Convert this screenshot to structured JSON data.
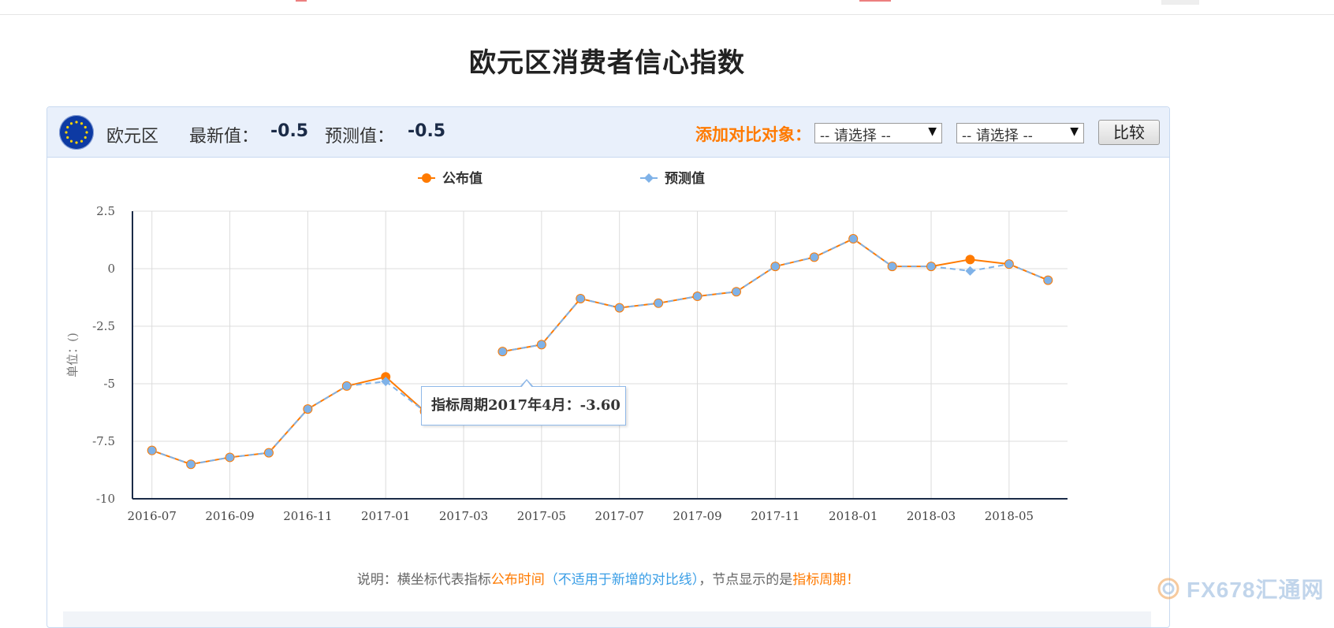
{
  "page": {
    "title": "欧元区消费者信心指数"
  },
  "header": {
    "region": "欧元区",
    "latest_label": "最新值：",
    "latest_value": "-0.5",
    "forecast_label": "预测值：",
    "forecast_value": "-0.5",
    "compare_label": "添加对比对象：",
    "select1": "-- 请选择 --",
    "select2": "-- 请选择 --",
    "compare_button": "比较"
  },
  "tooltip": {
    "text": "指标周期2017年4月：-3.60"
  },
  "footnote": {
    "prefix": "说明：横坐标代表指标",
    "highlight1": "公布时间",
    "paren": "（不适用于新增的对比线）",
    "middle": "，节点显示的是",
    "highlight2": "指标周期",
    "suffix": "！"
  },
  "watermark": "FX678汇通网",
  "chart_data": {
    "type": "line",
    "ylabel": "单位：()",
    "ylim": [
      -10,
      2.5
    ],
    "yticks": [
      2.5,
      0,
      -2.5,
      -5,
      -7.5,
      -10
    ],
    "ytick_labels": [
      "2.5",
      "0",
      "-2.5",
      "-5",
      "-7.5",
      "-10"
    ],
    "x": [
      "2016-07",
      "2016-08",
      "2016-09",
      "2016-10",
      "2016-11",
      "2016-12",
      "2017-01",
      "2017-02",
      "2017-03",
      "2017-04",
      "2017-05",
      "2017-06",
      "2017-07",
      "2017-08",
      "2017-09",
      "2017-10",
      "2017-11",
      "2017-12",
      "2018-01",
      "2018-02",
      "2018-03",
      "2018-04",
      "2018-05",
      "2018-06"
    ],
    "xtick_labels": [
      "2016-07",
      "2016-09",
      "2016-11",
      "2017-01",
      "2017-03",
      "2017-05",
      "2017-07",
      "2017-09",
      "2017-11",
      "2018-01",
      "2018-03",
      "2018-05"
    ],
    "grid": true,
    "legend_position": "top-center",
    "series": [
      {
        "name": "公布值",
        "color": "#ff7a00",
        "values": [
          -7.9,
          -8.5,
          -8.2,
          -8.0,
          -6.1,
          -5.1,
          -4.7,
          -6.2,
          null,
          -3.6,
          -3.3,
          -1.3,
          -1.7,
          -1.5,
          -1.2,
          -1.0,
          0.1,
          0.5,
          1.3,
          0.1,
          0.1,
          0.4,
          0.2,
          -0.5
        ]
      },
      {
        "name": "预测值",
        "color": "#7fb2e8",
        "values": [
          -7.9,
          -8.5,
          -8.2,
          -8.0,
          -6.1,
          -5.1,
          -4.9,
          -6.2,
          null,
          -3.6,
          -3.3,
          -1.3,
          -1.7,
          -1.5,
          -1.2,
          -1.0,
          0.1,
          0.5,
          1.3,
          0.1,
          0.1,
          -0.1,
          0.2,
          -0.5
        ]
      }
    ]
  }
}
